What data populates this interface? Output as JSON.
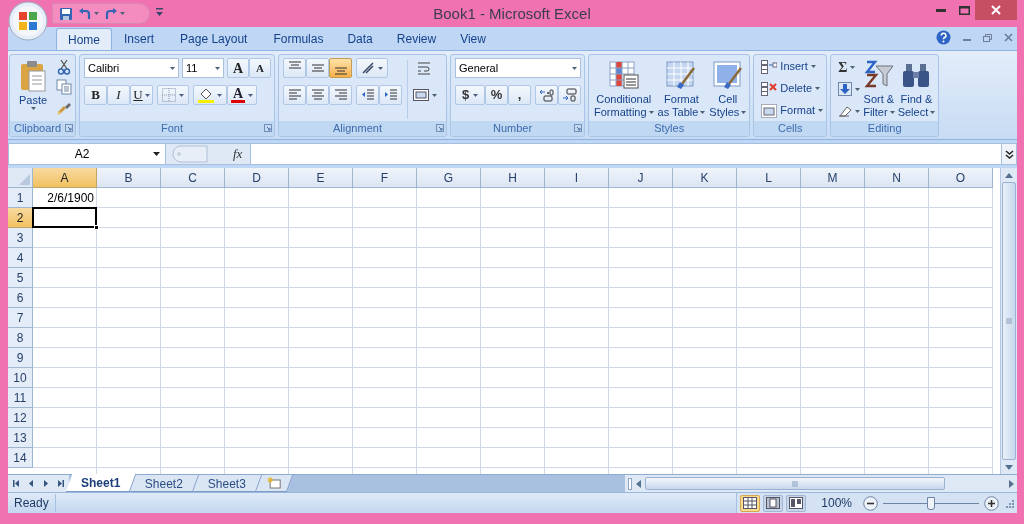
{
  "window": {
    "title": "Book1 - Microsoft Excel"
  },
  "ribbon": {
    "tabs": [
      {
        "label": "Home",
        "selected": true
      },
      {
        "label": "Insert",
        "selected": false
      },
      {
        "label": "Page Layout",
        "selected": false
      },
      {
        "label": "Formulas",
        "selected": false
      },
      {
        "label": "Data",
        "selected": false
      },
      {
        "label": "Review",
        "selected": false
      },
      {
        "label": "View",
        "selected": false
      }
    ],
    "clipboard": {
      "label": "Clipboard",
      "paste": "Paste"
    },
    "font": {
      "label": "Font",
      "font_name": "Calibri",
      "font_size": "11",
      "grow": "A",
      "shrink": "A",
      "style_buttons": [
        "B",
        "I",
        "U"
      ],
      "font_color": "A"
    },
    "alignment": {
      "label": "Alignment",
      "vertical_align": [
        {
          "selected": false
        },
        {
          "selected": false
        },
        {
          "selected": true
        }
      ]
    },
    "number": {
      "label": "Number",
      "format": "General",
      "buttons": [
        "$",
        "%",
        ","
      ]
    },
    "styles": {
      "label": "Styles",
      "buttons": [
        {
          "lines": [
            "Conditional",
            "Formatting"
          ]
        },
        {
          "lines": [
            "Format",
            "as Table"
          ]
        },
        {
          "lines": [
            "Cell",
            "Styles"
          ]
        }
      ]
    },
    "cells": {
      "label": "Cells",
      "buttons": [
        "Insert",
        "Delete",
        "Format"
      ]
    },
    "editing": {
      "label": "Editing",
      "autosum": "Σ",
      "buttons": [
        {
          "lines": [
            "Sort &",
            "Filter"
          ]
        },
        {
          "lines": [
            "Find &",
            "Select"
          ]
        }
      ]
    }
  },
  "formula_bar": {
    "name_box": "A2",
    "fx": "fx"
  },
  "sheet": {
    "columns": [
      {
        "label": "A",
        "selected": true
      },
      {
        "label": "B",
        "selected": false
      },
      {
        "label": "C",
        "selected": false
      },
      {
        "label": "D",
        "selected": false
      },
      {
        "label": "E",
        "selected": false
      },
      {
        "label": "F",
        "selected": false
      },
      {
        "label": "G",
        "selected": false
      },
      {
        "label": "H",
        "selected": false
      },
      {
        "label": "I",
        "selected": false
      },
      {
        "label": "J",
        "selected": false
      },
      {
        "label": "K",
        "selected": false
      },
      {
        "label": "L",
        "selected": false
      },
      {
        "label": "M",
        "selected": false
      },
      {
        "label": "N",
        "selected": false
      },
      {
        "label": "O",
        "selected": false
      }
    ],
    "rows": [
      {
        "label": "1",
        "selected": false,
        "values": [
          "2/6/1900"
        ]
      },
      {
        "label": "2",
        "selected": true
      },
      {
        "label": "3",
        "selected": false
      },
      {
        "label": "4",
        "selected": false
      },
      {
        "label": "5",
        "selected": false
      },
      {
        "label": "6",
        "selected": false
      },
      {
        "label": "7",
        "selected": false
      },
      {
        "label": "8",
        "selected": false
      },
      {
        "label": "9",
        "selected": false
      },
      {
        "label": "10",
        "selected": false
      },
      {
        "label": "11",
        "selected": false
      },
      {
        "label": "12",
        "selected": false
      },
      {
        "label": "13",
        "selected": false
      },
      {
        "label": "14",
        "selected": false
      }
    ]
  },
  "sheet_tabs": [
    {
      "label": "Sheet1",
      "selected": true
    },
    {
      "label": "Sheet2",
      "selected": false
    },
    {
      "label": "Sheet3",
      "selected": false
    }
  ],
  "status_bar": {
    "text": "Ready",
    "views": [
      {
        "selected": true
      },
      {
        "selected": false
      },
      {
        "selected": false
      }
    ],
    "zoom": "100%",
    "zoom_slider": {
      "level": 0.5
    }
  }
}
